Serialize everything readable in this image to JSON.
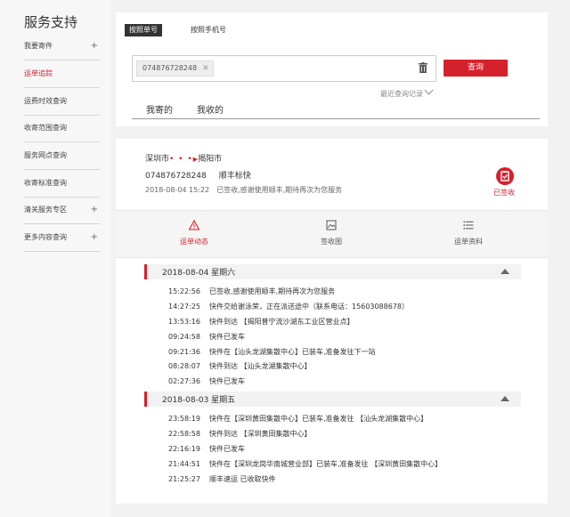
{
  "sidebar": {
    "title": "服务支持",
    "items": [
      {
        "label": "我要寄件",
        "plus": "+"
      },
      {
        "label": "运单追踪",
        "plus": ""
      },
      {
        "label": "运费时效查询",
        "plus": ""
      },
      {
        "label": "收寄范围查询",
        "plus": ""
      },
      {
        "label": "服务网点查询",
        "plus": ""
      },
      {
        "label": "收寄标准查询",
        "plus": ""
      },
      {
        "label": "清关服务专区",
        "plus": "+"
      },
      {
        "label": "更多内容查询",
        "plus": "+"
      }
    ],
    "active_index": 1
  },
  "search": {
    "tab_waybill": "按照单号",
    "tab_phone": "按照手机号",
    "chip_value": "074876728248",
    "chip_close": "✕",
    "query_label": "查询",
    "recent_label": "最近查询记录",
    "my_sent": "我寄的",
    "my_received": "我收的"
  },
  "result": {
    "origin": "深圳市",
    "route_dots": "• • •",
    "destination": "揭阳市",
    "waybill_no": "074876728248",
    "service": "顺丰标快",
    "last_time": "2018-08-04 15:22",
    "last_status": "已签收,感谢使用顺丰,期待再次为您服务",
    "signed_label": "已签收"
  },
  "detail_tabs": [
    {
      "label": "运单动态",
      "icon": "warning-triangle-icon"
    },
    {
      "label": "签收图",
      "icon": "image-icon"
    },
    {
      "label": "运单资料",
      "icon": "list-icon"
    }
  ],
  "timeline": [
    {
      "date": "2018-08-04 星期六",
      "events": [
        {
          "time": "15:22:56",
          "text": "已签收,感谢使用顺丰,期待再次为您服务"
        },
        {
          "time": "14:27:25",
          "text": "快件交给谢泳荣，正在派送途中（联系电话：15603088678）"
        },
        {
          "time": "13:53:16",
          "text": "快件到达 【揭阳普宁流沙湖东工业区营业点】"
        },
        {
          "time": "09:24:58",
          "text": "快件已发车"
        },
        {
          "time": "09:21:36",
          "text": "快件在【汕头龙湖集散中心】已装车,准备发往下一站"
        },
        {
          "time": "08:28:07",
          "text": "快件到达 【汕头龙湖集散中心】"
        },
        {
          "time": "02:27:36",
          "text": "快件已发车"
        }
      ]
    },
    {
      "date": "2018-08-03 星期五",
      "events": [
        {
          "time": "23:58:19",
          "text": "快件在【深圳黄田集散中心】已装车,准备发往 【汕头龙湖集散中心】"
        },
        {
          "time": "22:58:58",
          "text": "快件到达 【深圳黄田集散中心】"
        },
        {
          "time": "22:16:19",
          "text": "快件已发车"
        },
        {
          "time": "21:44:51",
          "text": "快件在【深圳龙岗华南城营业部】已装车,准备发往 【深圳黄田集散中心】"
        },
        {
          "time": "21:25:27",
          "text": "顺丰速运 已收取快件"
        }
      ]
    }
  ],
  "colors": {
    "accent": "#d5212b",
    "text": "#333333",
    "muted": "#666666"
  }
}
